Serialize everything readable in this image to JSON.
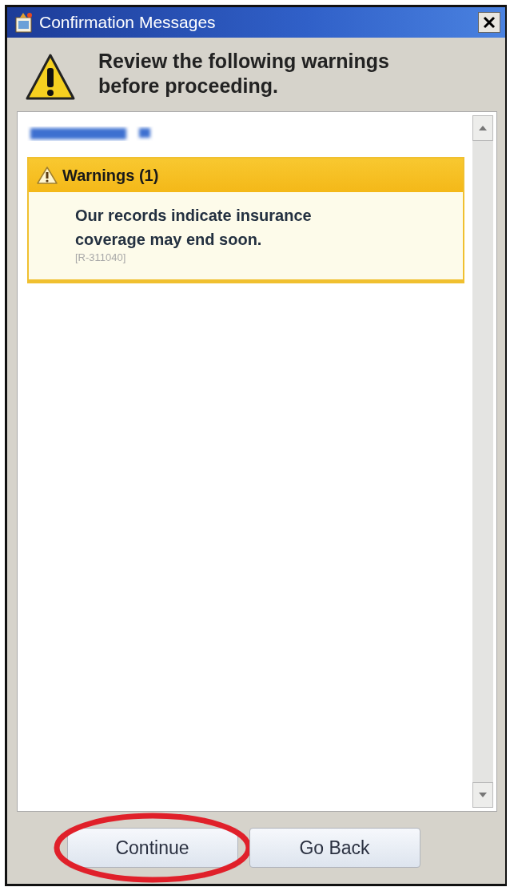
{
  "window": {
    "title": "Confirmation Messages"
  },
  "header": {
    "message": "Review the following warnings before proceeding."
  },
  "content": {
    "patient_name": {
      "kind": "blurred"
    },
    "sections": [
      {
        "kind": "warning",
        "title": "Warnings (1)",
        "items": [
          {
            "text": "Our records indicate insurance coverage may end soon.",
            "code": "[R-311040]"
          }
        ]
      }
    ]
  },
  "buttons": [
    {
      "label": "Continue",
      "circled": true
    },
    {
      "label": "Go Back",
      "circled": false
    }
  ]
}
